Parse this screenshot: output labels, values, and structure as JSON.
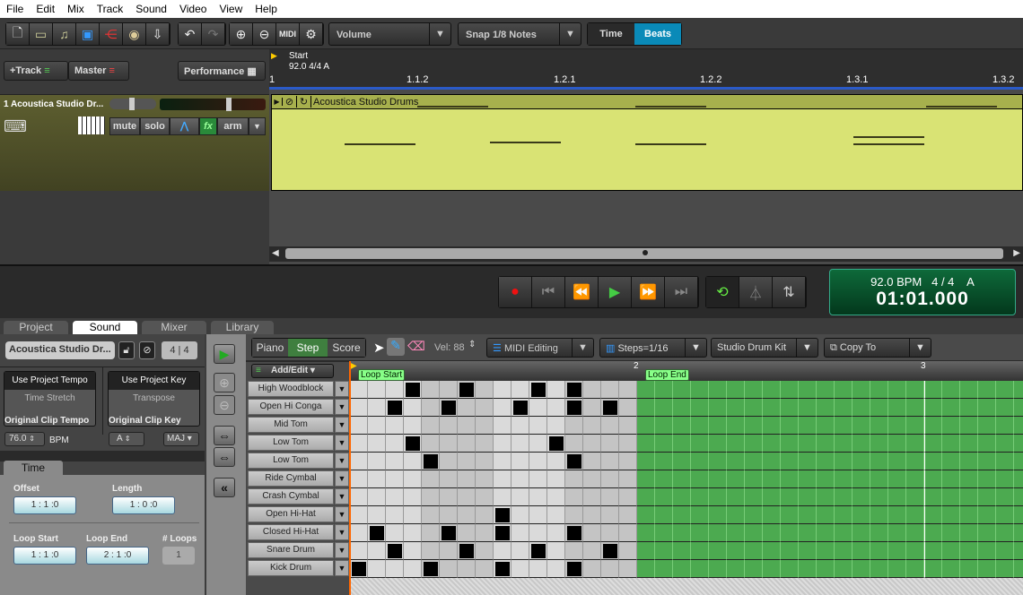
{
  "menu": [
    "File",
    "Edit",
    "Mix",
    "Track",
    "Sound",
    "Video",
    "View",
    "Help"
  ],
  "toolbar": {
    "icons": [
      "new-file",
      "open-folder",
      "open-music",
      "save",
      "share",
      "cd",
      "export-audio",
      "undo",
      "redo",
      "zoom-in",
      "zoom-out",
      "midi",
      "settings"
    ],
    "automation": "Volume",
    "snap": "Snap 1/8 Notes",
    "time_label": "Time",
    "beats_label": "Beats",
    "accent": "#0a8ab8"
  },
  "track_header": {
    "add_track": "+Track",
    "master": "Master",
    "performance": "Performance"
  },
  "track": {
    "name": "1 Acoustica Studio Dr...",
    "mute": "mute",
    "solo": "solo",
    "fx": "fx",
    "arm": "arm"
  },
  "ruler": {
    "start": "Start",
    "tempo_sig": "92.0 4/4 A",
    "marks": [
      "1",
      "1.1.2",
      "1.2.1",
      "1.2.2",
      "1.3.1",
      "1.3.2"
    ]
  },
  "clip": {
    "title": "Acoustica Studio Drums",
    "color": "#d9e374"
  },
  "transport": {
    "bpm": "92.0 BPM",
    "sig": "4 / 4",
    "key": "A",
    "time": "01:01.000"
  },
  "tabs": [
    "Project",
    "Sound",
    "Mixer",
    "Library"
  ],
  "sound": {
    "clip_name": "Acoustica Studio Dr...",
    "sig_num": "4",
    "sig_den": "4",
    "use_tempo": "Use Project Tempo",
    "time_stretch": "Time Stretch",
    "use_key": "Use Project Key",
    "transpose": "Transpose",
    "orig_tempo_label": "Original Clip Tempo",
    "orig_tempo": "76.0",
    "bpm": "BPM",
    "orig_key_label": "Original Clip Key",
    "key": "A",
    "scale": "MAJ",
    "time_tab": "Time",
    "offset_label": "Offset",
    "offset": "1 : 1 :0",
    "length_label": "Length",
    "length": "1 : 0 :0",
    "loop_start_label": "Loop Start",
    "loop_start": "1 : 1 :0",
    "loop_end_label": "Loop End",
    "loop_end": "2 : 1 :0",
    "loops_label": "# Loops",
    "loops": "1"
  },
  "editor": {
    "modes": [
      "Piano",
      "Step",
      "Score"
    ],
    "active_mode": "Step",
    "vel": "Vel: 88",
    "midi_editing": "MIDI Editing",
    "steps": "Steps=1/16",
    "kit": "Studio Drum Kit",
    "copy_to": "Copy To",
    "add_edit": "Add/Edit",
    "loop_start": "Loop Start",
    "loop_end": "Loop End",
    "bar_labels": [
      "2",
      "3"
    ],
    "rows": [
      {
        "name": "High Woodblock",
        "steps": [
          3,
          6,
          10,
          12
        ]
      },
      {
        "name": "Open Hi Conga",
        "steps": [
          2,
          5,
          9,
          12,
          14
        ]
      },
      {
        "name": "Mid Tom",
        "steps": []
      },
      {
        "name": "Low Tom",
        "steps": [
          3,
          11
        ]
      },
      {
        "name": "Low Tom",
        "steps": [
          4,
          12
        ]
      },
      {
        "name": "Ride Cymbal",
        "steps": []
      },
      {
        "name": "Crash Cymbal",
        "steps": []
      },
      {
        "name": "Open Hi-Hat",
        "steps": [
          8
        ]
      },
      {
        "name": "Closed Hi-Hat",
        "steps": [
          1,
          5,
          8,
          12
        ]
      },
      {
        "name": "Snare Drum",
        "steps": [
          2,
          6,
          10,
          14
        ]
      },
      {
        "name": "Kick Drum",
        "steps": [
          0,
          4,
          8,
          12
        ]
      }
    ]
  }
}
